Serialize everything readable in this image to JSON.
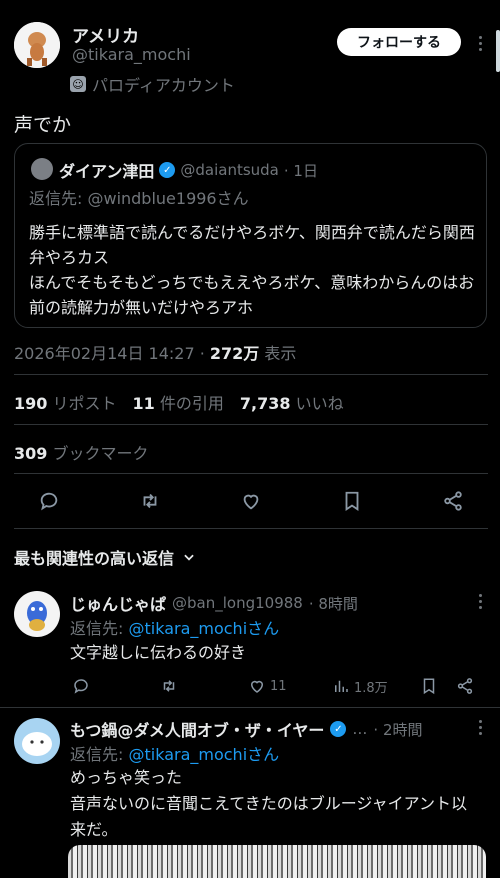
{
  "main_tweet": {
    "display_name": "アメリカ",
    "handle": "@tikara_mochi",
    "parody_label": "パロディアカウント",
    "follow_label": "フォローする",
    "text": "声でか",
    "quote": {
      "display_name": "ダイアン津田",
      "handle": "@daiantsuda",
      "time": "· 1日",
      "reply_to": "返信先: @windblue1996さん",
      "body": "勝手に標準語で読んでるだけやろボケ、関西弁で読んだら関西弁やろカス\nほんでそもそもどっちでもええやろボケ、意味わからんのはお前の読解力が無いだけやろアホ"
    },
    "timestamp": "2026年02月14日 14:27",
    "views_count": "272万",
    "views_label": "表示",
    "reposts_count": "190",
    "reposts_label": "リポスト",
    "quotes_count": "11",
    "quotes_label": "件の引用",
    "likes_count": "7,738",
    "likes_label": "いいね",
    "bookmarks_count": "309",
    "bookmarks_label": "ブックマーク"
  },
  "sort_label": "最も関連性の高い返信",
  "replies": [
    {
      "display_name": "じゅんじゃぱ",
      "handle": "@ban_long10988",
      "time": "· 8時間",
      "reply_prefix": "返信先: ",
      "reply_to": "@tikara_mochiさん",
      "text": "文字越しに伝わるの好き",
      "likes": "11",
      "views": "1.8万"
    },
    {
      "display_name": "もつ鍋@ダメ人間オブ・ザ・イヤー",
      "handle": "…",
      "time": "· 2時間",
      "reply_prefix": "返信先: ",
      "reply_to": "@tikara_mochiさん",
      "text": "めっちゃ笑った\n音声ないのに音聞こえてきたのはブルージャイアント以来だ。"
    }
  ],
  "colors": {
    "accent": "#1d9bf0",
    "muted": "#71767b",
    "background": "#000000",
    "divider": "#2f3336"
  }
}
